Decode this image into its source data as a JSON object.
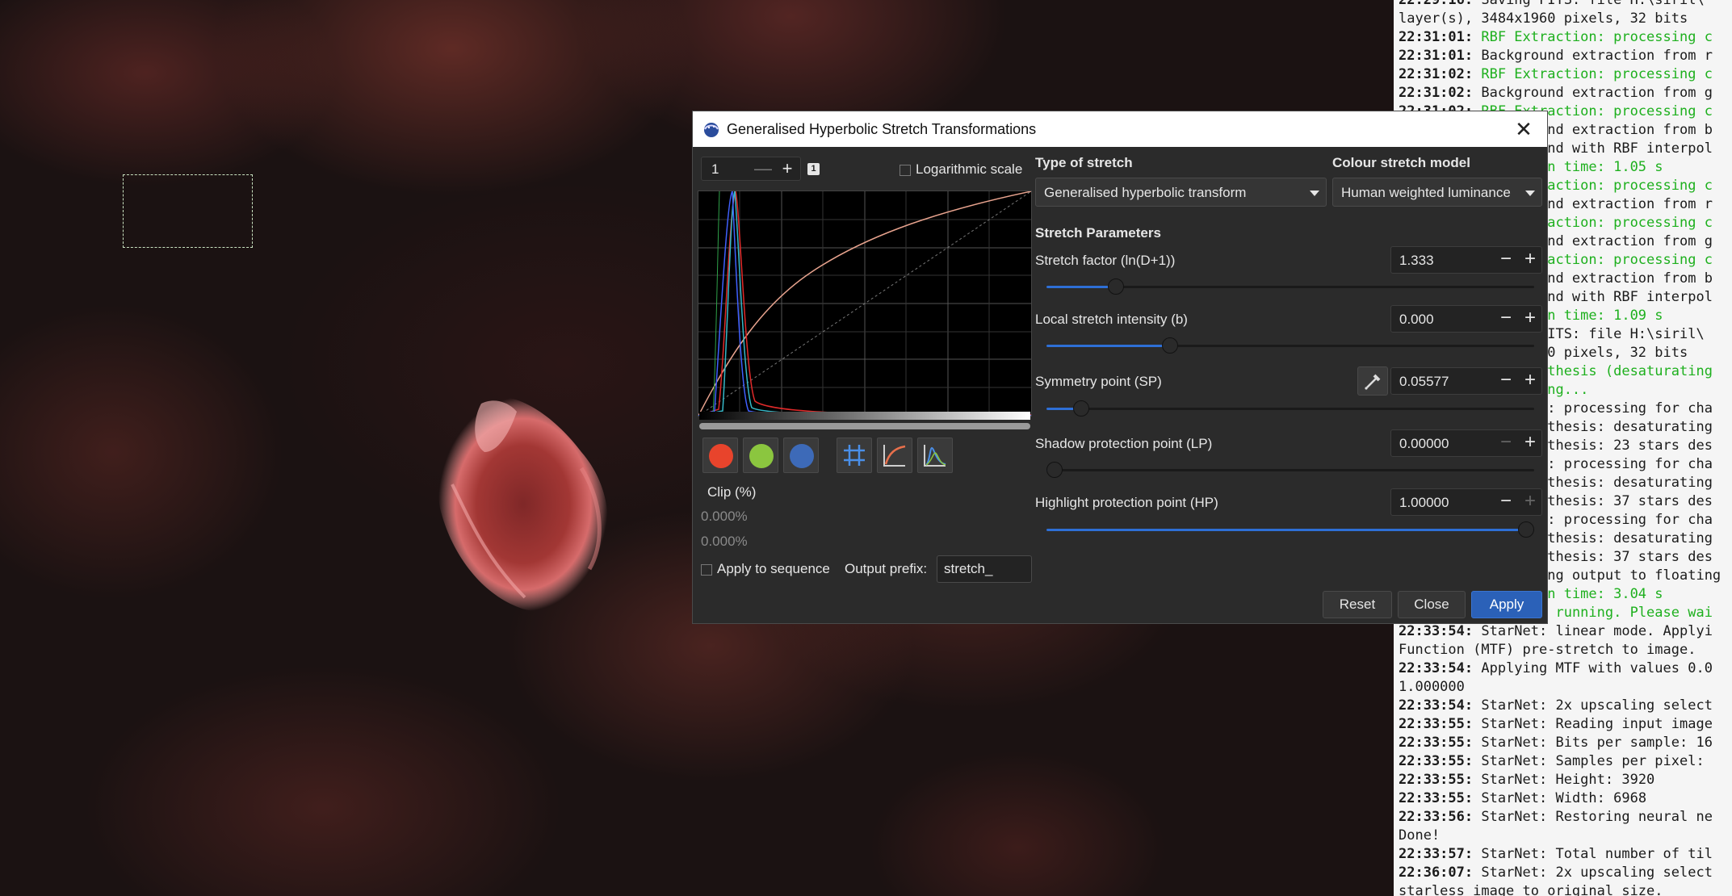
{
  "dialog": {
    "title": "Generalised Hyperbolic Stretch Transformations",
    "close_glyph": "✕",
    "zoom_value": "1",
    "zoom_minus": "—",
    "zoom_plus": "+",
    "zoom_badge": "1",
    "log_scale_label": "Logarithmic scale",
    "log_scale_checked": false,
    "clip_label": "Clip (%)",
    "clip_low": "0.000%",
    "clip_high": "0.000%",
    "apply_sequence_label": "Apply to sequence",
    "output_prefix_label": "Output prefix:",
    "output_prefix_value": "stretch_",
    "type_of_stretch_label": "Type of stretch",
    "type_of_stretch_value": "Generalised hyperbolic transform",
    "colour_model_label": "Colour stretch model",
    "colour_model_value": "Human weighted luminance",
    "stretch_params_label": "Stretch Parameters",
    "params": [
      {
        "label": "Stretch factor (ln(D+1))",
        "value": "1.333",
        "slider": 0.13
      },
      {
        "label": "Local stretch intensity (b)",
        "value": "0.000",
        "slider": 0.245
      },
      {
        "label": "Symmetry point (SP)",
        "value": "0.05577",
        "slider": 0.056
      },
      {
        "label": "Shadow protection point (LP)",
        "value": "0.00000",
        "slider": 0.0
      },
      {
        "label": "Highlight protection point (HP)",
        "value": "1.00000",
        "slider": 1.0
      }
    ],
    "reset_label": "Reset",
    "close_label": "Close",
    "apply_label": "Apply"
  },
  "channel_colors": {
    "red": "#e8442c",
    "green": "#8bc63f",
    "blue": "#3d6ab8"
  },
  "log_lines": [
    {
      "ts": "22:29:16:",
      "text": " Saving FITS: file H:\\siril\\",
      "green": false
    },
    {
      "ts": "",
      "text": "layer(s), 3484x1960 pixels, 32 bits",
      "green": false
    },
    {
      "ts": "22:31:01:",
      "text": " RBF Extraction: processing c",
      "green": true
    },
    {
      "ts": "22:31:01:",
      "text": " Background extraction from r",
      "green": false
    },
    {
      "ts": "22:31:02:",
      "text": " RBF Extraction: processing c",
      "green": true
    },
    {
      "ts": "22:31:02:",
      "text": " Background extraction from g",
      "green": false
    },
    {
      "ts": "22:31:02:",
      "text": " RBF Extraction: processing c",
      "green": true
    },
    {
      "ts": "",
      "text": "22:31:02: Background extraction from b",
      "green": false
    },
    {
      "ts": "",
      "text": "22:31:02: Background with RBF interpol",
      "green": false
    },
    {
      "ts": "",
      "text": "22:31:02: Execution time: 1.05 s",
      "green": true
    },
    {
      "ts": "",
      "text": "22:31:03: RBF Extraction: processing c",
      "green": true
    },
    {
      "ts": "",
      "text": "22:31:03: Background extraction from r",
      "green": false
    },
    {
      "ts": "",
      "text": "22:31:03: RBF Extraction: processing c",
      "green": true
    },
    {
      "ts": "",
      "text": "22:31:03: Background extraction from g",
      "green": false
    },
    {
      "ts": "",
      "text": "22:31:03: RBF Extraction: processing c",
      "green": true
    },
    {
      "ts": "",
      "text": "22:31:03: Background extraction from b",
      "green": false
    },
    {
      "ts": "",
      "text": "22:31:03: Background with RBF interpol",
      "green": false
    },
    {
      "ts": "",
      "text": "22:31:04: Execution time: 1.09 s",
      "green": true
    },
    {
      "ts": "",
      "text": "22:31:48: Saving FITS: file H:\\siril\\",
      "green": false
    },
    {
      "ts": "",
      "text": "layer(s), 3484x1960 pixels, 32 bits",
      "green": false
    },
    {
      "ts": "",
      "text": "22:32:10: Star synthesis (desaturating",
      "green": true
    },
    {
      "ts": "",
      "text": "22:32:10: Processing...",
      "green": true
    },
    {
      "ts": "",
      "text": "22:32:10: Findstar: processing for cha",
      "green": false
    },
    {
      "ts": "",
      "text": "22:32:11: Star synthesis: desaturating",
      "green": false
    },
    {
      "ts": "",
      "text": "22:32:11: Star synthesis: 23 stars des",
      "green": false
    },
    {
      "ts": "",
      "text": "22:32:11: Findstar: processing for cha",
      "green": false
    },
    {
      "ts": "",
      "text": "22:32:12: Star synthesis: desaturating",
      "green": false
    },
    {
      "ts": "",
      "text": "22:32:12: Star synthesis: 37 stars des",
      "green": false
    },
    {
      "ts": "",
      "text": "22:32:12: Findstar: processing for cha",
      "green": false
    },
    {
      "ts": "",
      "text": "22:32:13: Star synthesis: desaturating",
      "green": false
    },
    {
      "ts": "",
      "text": "22:32:13: Star synthesis: 37 stars des",
      "green": false
    },
    {
      "ts": "",
      "text": "22:32:13: Converting output to floating",
      "green": false
    },
    {
      "ts": "",
      "text": "",
      "green": false
    },
    {
      "ts": "",
      "text": "22:32:13: Execution time: 3.04 s",
      "green": true
    },
    {
      "ts": "22:33:54:",
      "text": " StarNet: running. Please wai",
      "green": true
    },
    {
      "ts": "22:33:54:",
      "text": " StarNet: linear mode. Applyi",
      "green": false
    },
    {
      "ts": "",
      "text": "Function (MTF) pre-stretch to image.",
      "green": false
    },
    {
      "ts": "22:33:54:",
      "text": " Applying MTF with values 0.0",
      "green": false
    },
    {
      "ts": "",
      "text": "1.000000",
      "green": false
    },
    {
      "ts": "22:33:54:",
      "text": " StarNet: 2x upscaling select",
      "green": false
    },
    {
      "ts": "22:33:55:",
      "text": " StarNet: Reading input image",
      "green": false
    },
    {
      "ts": "22:33:55:",
      "text": " StarNet: Bits per sample: 16",
      "green": false
    },
    {
      "ts": "22:33:55:",
      "text": " StarNet: Samples per pixel: ",
      "green": false
    },
    {
      "ts": "22:33:55:",
      "text": " StarNet: Height: 3920",
      "green": false
    },
    {
      "ts": "22:33:55:",
      "text": " StarNet: Width: 6968",
      "green": false
    },
    {
      "ts": "22:33:56:",
      "text": " StarNet: Restoring neural ne",
      "green": false
    },
    {
      "ts": "",
      "text": "Done!",
      "green": false
    },
    {
      "ts": "22:33:57:",
      "text": " StarNet: Total number of til",
      "green": false
    },
    {
      "ts": "22:36:07:",
      "text": " StarNet: 2x upscaling select",
      "green": false
    },
    {
      "ts": "",
      "text": "starless image to original size.",
      "green": false
    }
  ]
}
